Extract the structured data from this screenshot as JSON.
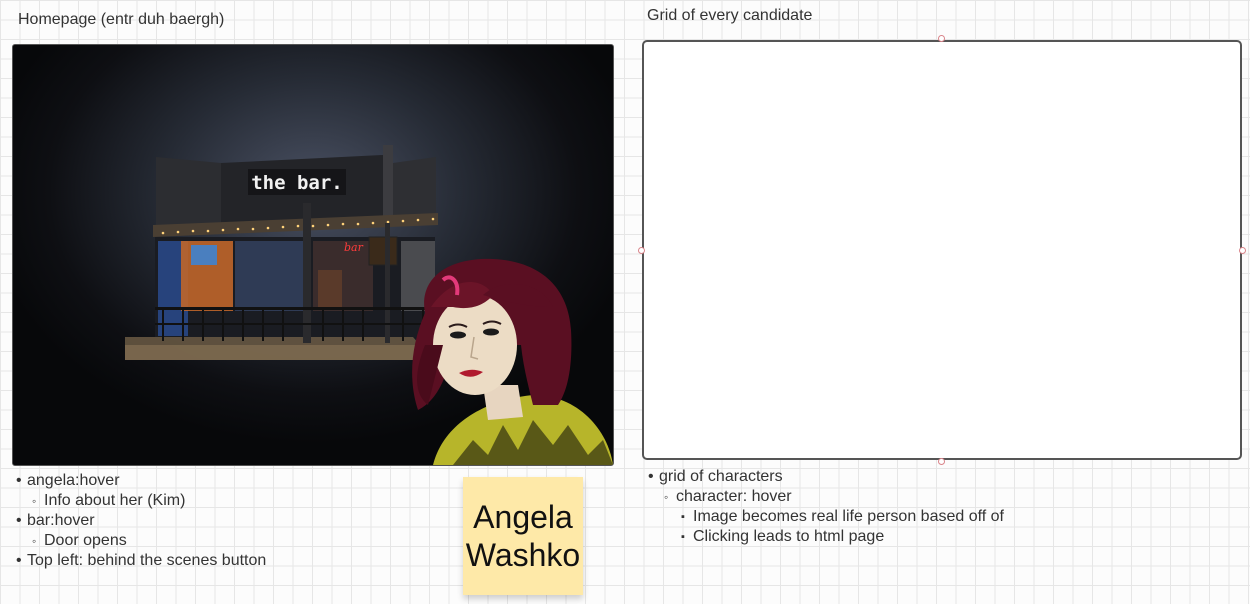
{
  "homepage": {
    "title": "Homepage (entr duh baergh)",
    "bar_sign": "the bar.",
    "neon_sign": "bar",
    "notes": [
      {
        "level": 1,
        "text": "angela:hover"
      },
      {
        "level": 2,
        "text": "Info about her (Kim)"
      },
      {
        "level": 1,
        "text": "bar:hover"
      },
      {
        "level": 2,
        "text": "Door opens"
      },
      {
        "level": 1,
        "text": "Top left: behind the scenes button"
      }
    ]
  },
  "sticky_note": {
    "line1": "Angela",
    "line2": "Washko"
  },
  "grid": {
    "title": "Grid of every candidate",
    "notes": [
      {
        "level": 1,
        "text": "grid of characters"
      },
      {
        "level": 2,
        "text": "character: hover"
      },
      {
        "level": 3,
        "text": "Image becomes real life person based off of"
      },
      {
        "level": 3,
        "text": "Clicking leads to html page"
      }
    ]
  },
  "colors": {
    "sticky": "#fee9a8",
    "handle_border": "#d9848a",
    "grid_line": "#e6e6e6"
  }
}
